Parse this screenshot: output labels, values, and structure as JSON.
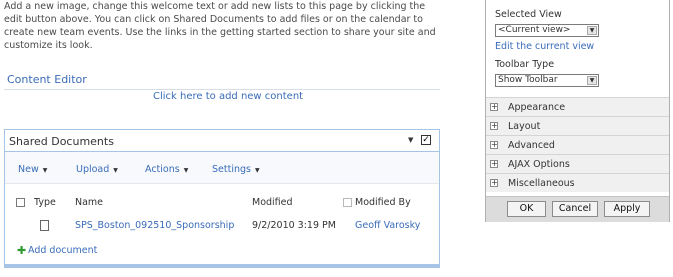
{
  "intro": {
    "text": "Add a new image, change this welcome text or add new lists to this page by clicking the edit button above. You can click on Shared Documents to add files or on the calendar to create new team events. Use the links in the getting started section to share your site and customize its look."
  },
  "content_editor": {
    "title": "Content Editor",
    "link": "Click here to add new content"
  },
  "shared_documents": {
    "title": "Shared Documents",
    "toolbar": {
      "new": "New",
      "upload": "Upload",
      "actions": "Actions",
      "settings": "Settings"
    },
    "columns": {
      "type": "Type",
      "name": "Name",
      "modified": "Modified",
      "modified_by": "Modified By"
    },
    "rows": [
      {
        "name": "SPS_Boston_092510_Sponsorship",
        "modified": "9/2/2010 3:19 PM",
        "modified_by": "Geoff Varosky"
      }
    ],
    "add_document": "Add document"
  },
  "tool_pane": {
    "selected_view_label": "Selected View",
    "selected_view_value": "<Current view>",
    "edit_current_view": "Edit the current view",
    "toolbar_type_label": "Toolbar Type",
    "toolbar_type_value": "Show Toolbar",
    "sections": [
      "Appearance",
      "Layout",
      "Advanced",
      "AJAX Options",
      "Miscellaneous"
    ],
    "buttons": {
      "ok": "OK",
      "cancel": "Cancel",
      "apply": "Apply"
    }
  }
}
